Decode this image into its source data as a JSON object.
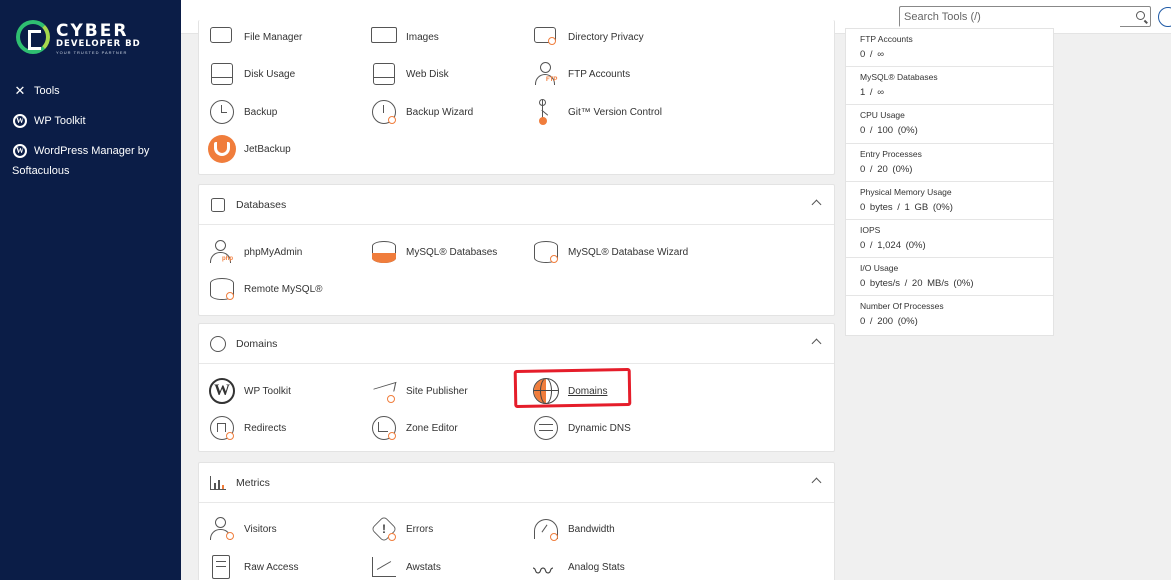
{
  "brand": {
    "name": "CYBER",
    "sub": "DEVELOPER BD",
    "tag": "YOUR TRUSTED PARTNER"
  },
  "sidebar": {
    "items": [
      {
        "label": "Tools",
        "icon": "tools-icon"
      },
      {
        "label": "WP Toolkit",
        "icon": "wordpress-icon"
      },
      {
        "label": "WordPress Manager by Softaculous",
        "icon": "wordpress-icon"
      }
    ]
  },
  "search": {
    "placeholder": "Search Tools (/)"
  },
  "files": {
    "items": [
      {
        "label": "File Manager"
      },
      {
        "label": "Images"
      },
      {
        "label": "Directory Privacy"
      },
      {
        "label": "Disk Usage"
      },
      {
        "label": "Web Disk"
      },
      {
        "label": "FTP Accounts"
      },
      {
        "label": "Backup"
      },
      {
        "label": "Backup Wizard"
      },
      {
        "label": "Git™ Version Control"
      },
      {
        "label": "JetBackup"
      }
    ]
  },
  "databases": {
    "title": "Databases",
    "items": [
      {
        "label": "phpMyAdmin"
      },
      {
        "label": "MySQL® Databases"
      },
      {
        "label": "MySQL® Database Wizard"
      },
      {
        "label": "Remote MySQL®"
      }
    ]
  },
  "domains": {
    "title": "Domains",
    "items": [
      {
        "label": "WP Toolkit"
      },
      {
        "label": "Site Publisher"
      },
      {
        "label": "Domains"
      },
      {
        "label": "Redirects"
      },
      {
        "label": "Zone Editor"
      },
      {
        "label": "Dynamic DNS"
      }
    ]
  },
  "metrics": {
    "title": "Metrics",
    "items": [
      {
        "label": "Visitors"
      },
      {
        "label": "Errors"
      },
      {
        "label": "Bandwidth"
      },
      {
        "label": "Raw Access"
      },
      {
        "label": "Awstats"
      },
      {
        "label": "Analog Stats"
      }
    ]
  },
  "stats": [
    {
      "label": "FTP Accounts",
      "value": "0 / ∞"
    },
    {
      "label": "MySQL® Databases",
      "value": "1 / ∞"
    },
    {
      "label": "CPU Usage",
      "value": "0 / 100   (0%)"
    },
    {
      "label": "Entry Processes",
      "value": "0 / 20   (0%)"
    },
    {
      "label": "Physical Memory Usage",
      "value": "0 bytes / 1 GB   (0%)"
    },
    {
      "label": "IOPS",
      "value": "0 / 1,024   (0%)"
    },
    {
      "label": "I/O Usage",
      "value": "0 bytes/s / 20 MB/s   (0%)"
    },
    {
      "label": "Number Of Processes",
      "value": "0 / 200   (0%)"
    }
  ],
  "colors": {
    "sidebar": "#0b1d47",
    "accent": "#f07d3c",
    "highlight": "#e51d2a"
  }
}
